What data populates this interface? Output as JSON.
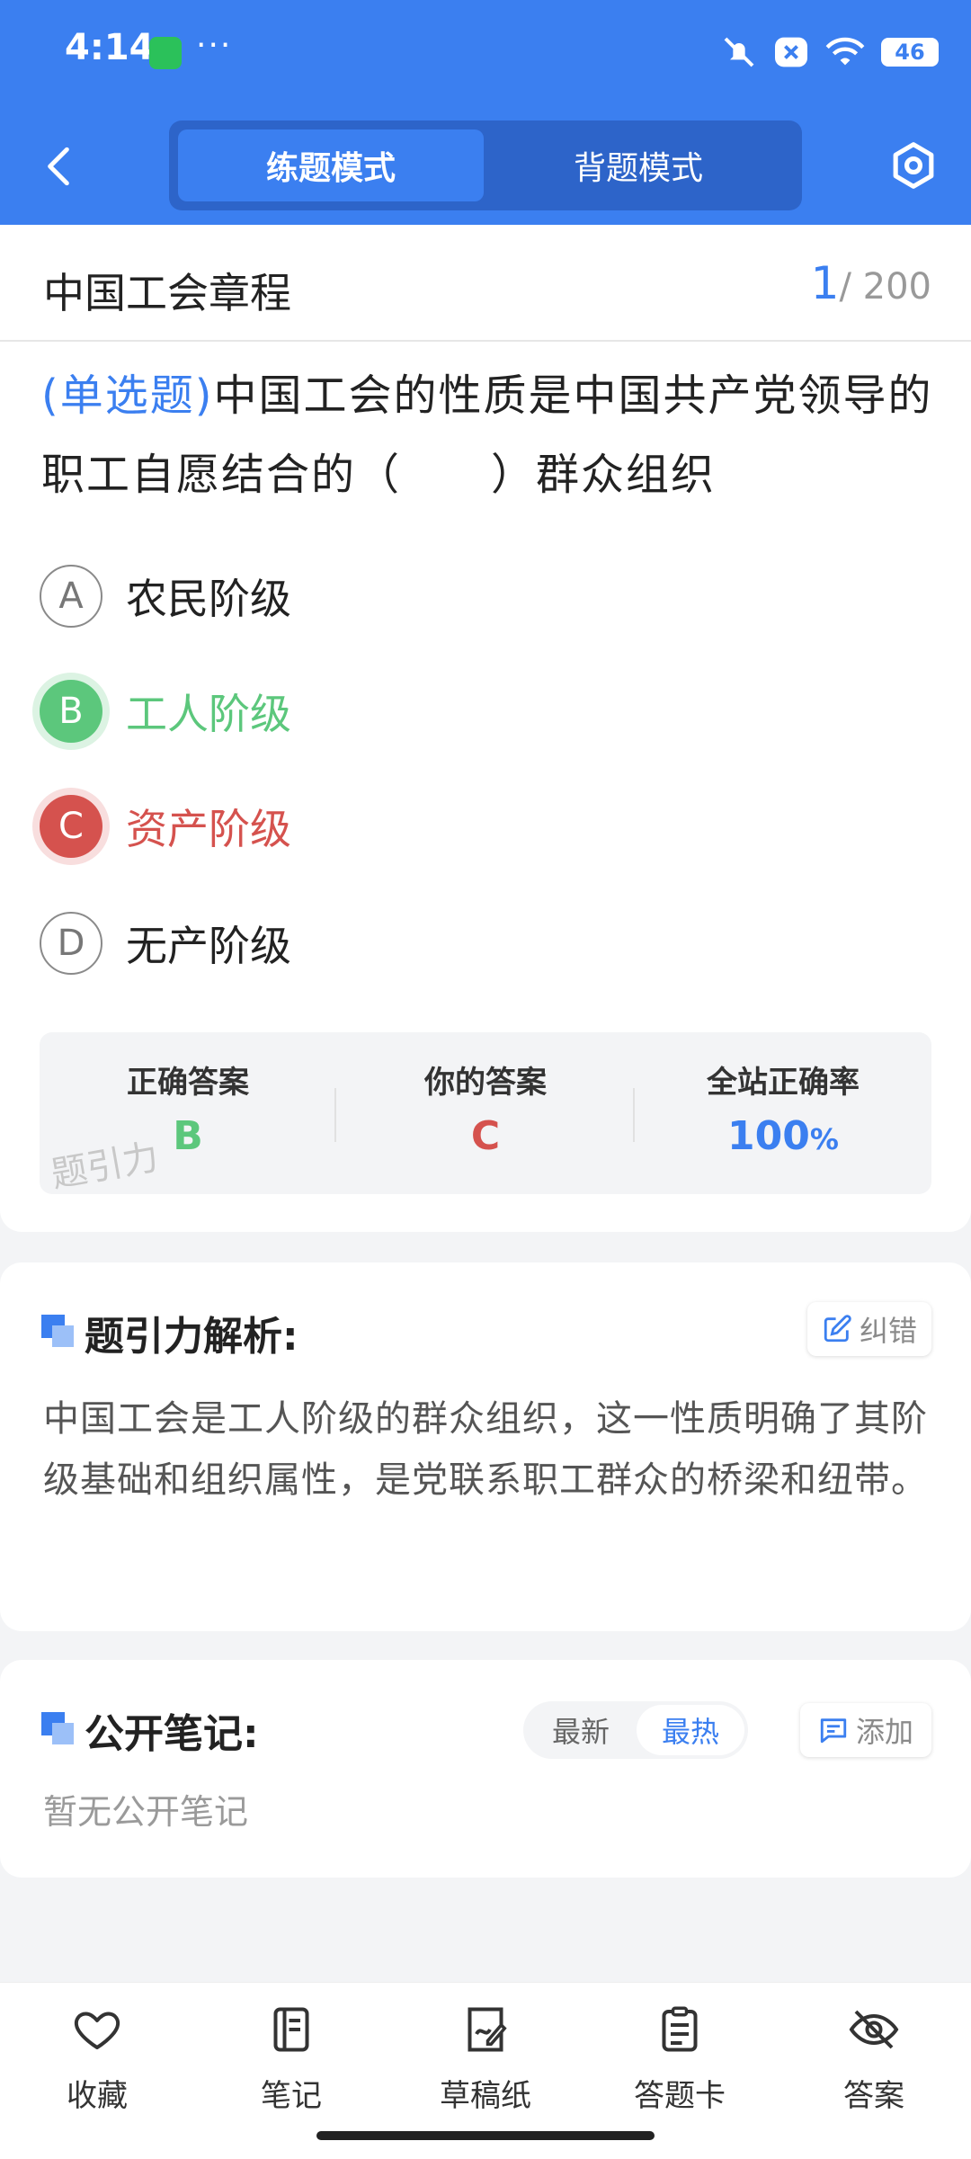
{
  "status_bar": {
    "time": "4:14",
    "dots": "···",
    "battery": "46"
  },
  "header": {
    "tabs": [
      "练题模式",
      "背题模式"
    ],
    "active_tab": "练题模式"
  },
  "question": {
    "chapter": "中国工会章程",
    "current": "1",
    "total": "/ 200",
    "type": "(单选题)",
    "text": "中国工会的性质是中国共产党领导的职工自愿结合的（　　）群众组织",
    "options": [
      {
        "letter": "A",
        "text": "农民阶级",
        "state": "normal"
      },
      {
        "letter": "B",
        "text": "工人阶级",
        "state": "correct"
      },
      {
        "letter": "C",
        "text": "资产阶级",
        "state": "wrong"
      },
      {
        "letter": "D",
        "text": "无产阶级",
        "state": "normal"
      }
    ]
  },
  "result": {
    "correct_label": "正确答案",
    "correct_value": "B",
    "yours_label": "你的答案",
    "yours_value": "C",
    "rate_label": "全站正确率",
    "rate_value": "100",
    "rate_unit": "%",
    "watermark": "题引力"
  },
  "analysis": {
    "title": "题引力解析:",
    "report_label": "纠错",
    "text": "中国工会是工人阶级的群众组织，这一性质明确了其阶级基础和组织属性，是党联系职工群众的桥梁和纽带。"
  },
  "notes": {
    "title": "公开笔记:",
    "sort_new": "最新",
    "sort_hot": "最热",
    "add_label": "添加",
    "empty_text": "暂无公开笔记"
  },
  "bottom_nav": [
    {
      "label": "收藏",
      "icon": "heart-icon"
    },
    {
      "label": "笔记",
      "icon": "notebook-icon"
    },
    {
      "label": "草稿纸",
      "icon": "draft-icon"
    },
    {
      "label": "答题卡",
      "icon": "answer-card-icon"
    },
    {
      "label": "答案",
      "icon": "eye-off-icon"
    }
  ],
  "colors": {
    "primary": "#3b7ff0",
    "correct": "#5cc77c",
    "wrong": "#d5524e"
  }
}
